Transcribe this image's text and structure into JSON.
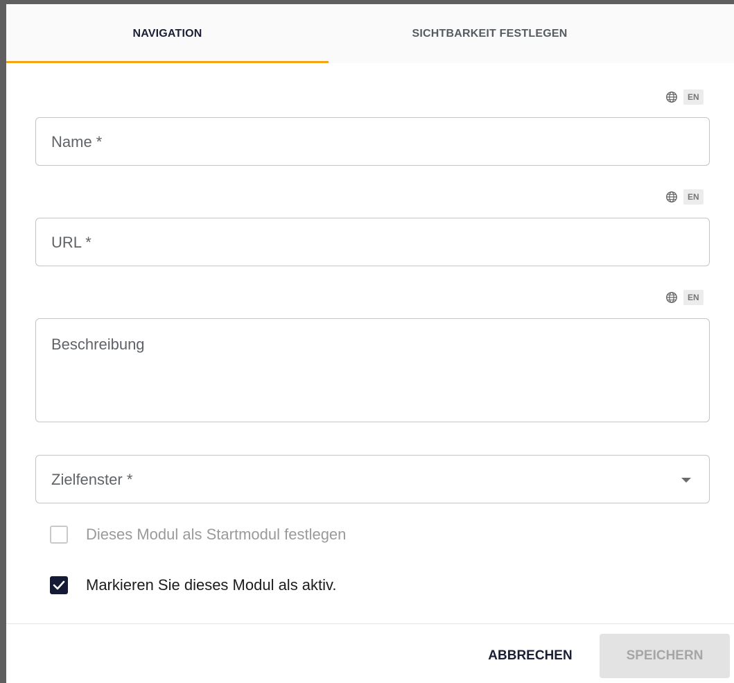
{
  "tabs": [
    {
      "label": "NAVIGATION",
      "active": true
    },
    {
      "label": "SICHTBARKEIT FESTLEGEN",
      "active": false
    }
  ],
  "language_badge": {
    "icon": "globe-icon",
    "code": "EN"
  },
  "form": {
    "name": {
      "label": "Name *",
      "value": ""
    },
    "url": {
      "label": "URL *",
      "value": ""
    },
    "description": {
      "label": "Beschreibung",
      "value": ""
    },
    "target_window": {
      "label": "Zielfenster *",
      "selected": "",
      "icon": "chevron-down-icon"
    },
    "start_module": {
      "label": "Dieses Modul als Startmodul festlegen",
      "checked": false,
      "disabled": true
    },
    "active_module": {
      "label": "Markieren Sie dieses Modul als aktiv.",
      "checked": true,
      "disabled": false
    }
  },
  "actions": {
    "cancel_label": "ABBRECHEN",
    "save_label": "SPEICHERN",
    "save_disabled": true
  },
  "colors": {
    "accent": "#f5a30f",
    "checkbox_checked": "#141a33",
    "text_dark": "#1a1f36"
  }
}
